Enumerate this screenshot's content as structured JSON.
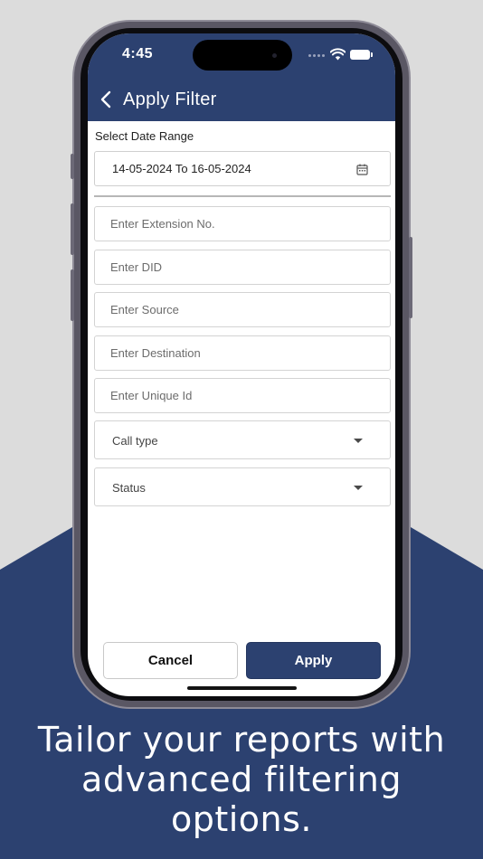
{
  "status_bar": {
    "time": "4:45"
  },
  "header": {
    "title": "Apply Filter",
    "background": "#2c4170"
  },
  "date_range": {
    "label": "Select Date Range",
    "value": "14-05-2024 To 16-05-2024",
    "icon": "calendar-icon"
  },
  "fields": {
    "extension_placeholder": "Enter Extension No.",
    "did_placeholder": "Enter DID",
    "source_placeholder": "Enter Source",
    "destination_placeholder": "Enter Destination",
    "unique_id_placeholder": "Enter Unique Id"
  },
  "dropdowns": {
    "call_type": "Call type",
    "status": "Status"
  },
  "actions": {
    "cancel_label": "Cancel",
    "apply_label": "Apply"
  },
  "tagline": {
    "line1": "Tailor your reports with",
    "line2": "advanced filtering",
    "line3": "options."
  },
  "colors": {
    "brand_navy": "#2c4170",
    "page_gray": "#dcdcdc"
  }
}
